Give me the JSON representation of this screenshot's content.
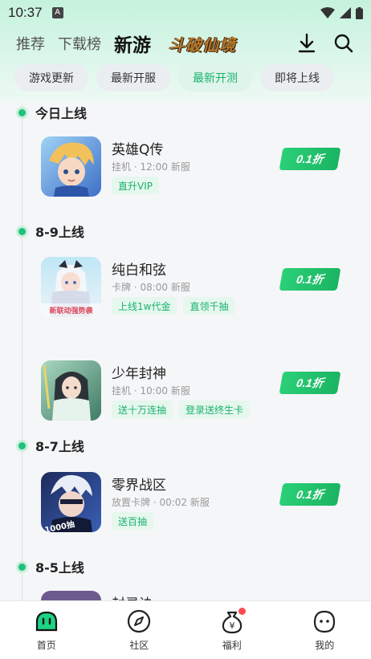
{
  "status": {
    "time": "10:37",
    "notif_icon": "A"
  },
  "topnav": {
    "tabs": [
      "推荐",
      "下载榜",
      "新游"
    ],
    "active_tab": "新游",
    "banner_text": "斗破仙境"
  },
  "chips": [
    "游戏更新",
    "最新开服",
    "最新开测",
    "即将上线"
  ],
  "active_chip": "最新开测",
  "sections": [
    {
      "date": "今日上线",
      "games": [
        {
          "title": "英雄Q传",
          "meta": "挂机 · 12:00 新服",
          "tags": [
            "直升VIP"
          ],
          "discount": "0.1折"
        }
      ]
    },
    {
      "date": "8-9上线",
      "games": [
        {
          "title": "纯白和弦",
          "meta": "卡牌 · 08:00 新服",
          "tags": [
            "上线1w代金",
            "直领千抽"
          ],
          "discount": "0.1折",
          "cover_text": "新联动强势袭"
        },
        {
          "title": "少年封神",
          "meta": "挂机 · 10:00 新服",
          "tags": [
            "送十万连抽",
            "登录送终生卡"
          ],
          "discount": "0.1折"
        }
      ]
    },
    {
      "date": "8-7上线",
      "games": [
        {
          "title": "零界战区",
          "meta": "放置卡牌 · 00:02 新服",
          "tags": [
            "送百抽"
          ],
          "discount": "0.1折",
          "cover_text": "1000抽"
        }
      ]
    },
    {
      "date": "8-5上线",
      "games": [
        {
          "title": "封灵诀",
          "meta": "",
          "tags": [],
          "discount": ""
        }
      ]
    }
  ],
  "bottom_nav": [
    "首页",
    "社区",
    "福利",
    "我的"
  ],
  "colors": {
    "accent": "#22c07a",
    "tag_bg": "#e6f7ee",
    "badge": "#ff4d4f"
  }
}
